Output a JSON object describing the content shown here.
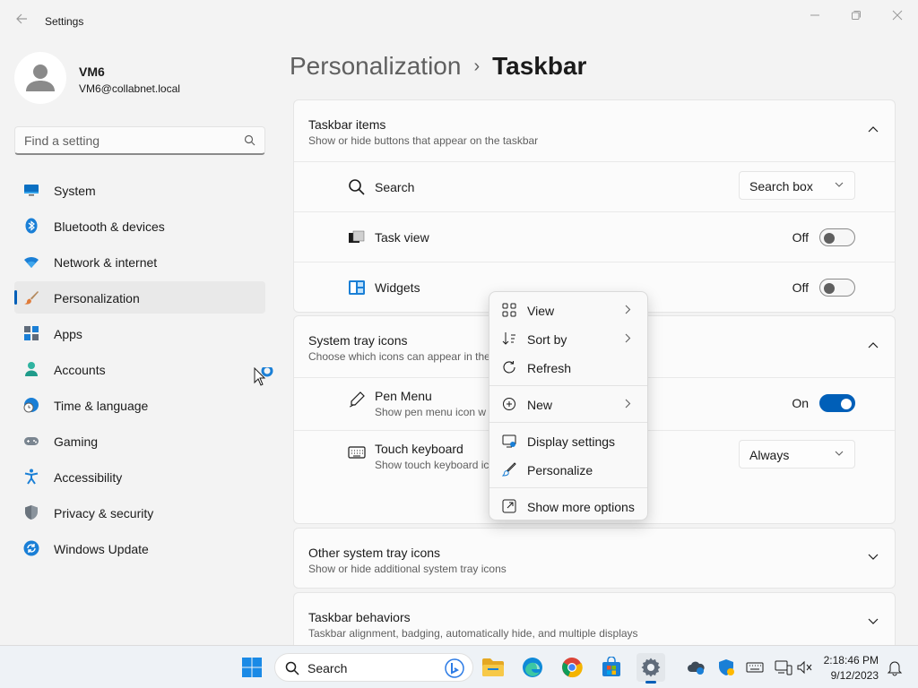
{
  "window": {
    "title": "Settings"
  },
  "user": {
    "name": "VM6",
    "email": "VM6@collabnet.local"
  },
  "search": {
    "placeholder": "Find a setting"
  },
  "nav": [
    {
      "label": "System",
      "icon": "monitor-icon"
    },
    {
      "label": "Bluetooth & devices",
      "icon": "bluetooth-icon"
    },
    {
      "label": "Network & internet",
      "icon": "wifi-icon"
    },
    {
      "label": "Personalization",
      "icon": "brush-icon",
      "active": true
    },
    {
      "label": "Apps",
      "icon": "apps-icon"
    },
    {
      "label": "Accounts",
      "icon": "person-icon"
    },
    {
      "label": "Time & language",
      "icon": "globe-clock-icon"
    },
    {
      "label": "Gaming",
      "icon": "gamepad-icon"
    },
    {
      "label": "Accessibility",
      "icon": "accessibility-icon"
    },
    {
      "label": "Privacy & security",
      "icon": "shield-icon"
    },
    {
      "label": "Windows Update",
      "icon": "update-icon"
    }
  ],
  "breadcrumb": {
    "parent": "Personalization",
    "separator": "›",
    "current": "Taskbar"
  },
  "taskbar_items": {
    "title": "Taskbar items",
    "description": "Show or hide buttons that appear on the taskbar",
    "search": {
      "label": "Search",
      "value": "Search box"
    },
    "task_view": {
      "label": "Task view",
      "state": "Off"
    },
    "widgets": {
      "label": "Widgets",
      "state": "Off"
    }
  },
  "system_tray": {
    "title": "System tray icons",
    "description": "Choose which icons can appear in the",
    "pen_menu": {
      "label": "Pen Menu",
      "sub": "Show pen menu icon w",
      "state": "On"
    },
    "touch_keyboard": {
      "label": "Touch keyboard",
      "sub": "Show touch keyboard ic",
      "value": "Always"
    }
  },
  "other_tray": {
    "title": "Other system tray icons",
    "description": "Show or hide additional system tray icons"
  },
  "behaviors": {
    "title": "Taskbar behaviors",
    "description": "Taskbar alignment, badging, automatically hide, and multiple displays"
  },
  "context_menu": {
    "view": "View",
    "sort_by": "Sort by",
    "refresh": "Refresh",
    "new": "New",
    "display_settings": "Display settings",
    "personalize": "Personalize",
    "more_options": "Show more options"
  },
  "taskbar": {
    "search_label": "Search",
    "time": "2:18:46 PM",
    "date": "9/12/2023"
  },
  "colors": {
    "accent": "#005fb8",
    "background": "#f3f3f3",
    "card": "#fbfbfb"
  }
}
